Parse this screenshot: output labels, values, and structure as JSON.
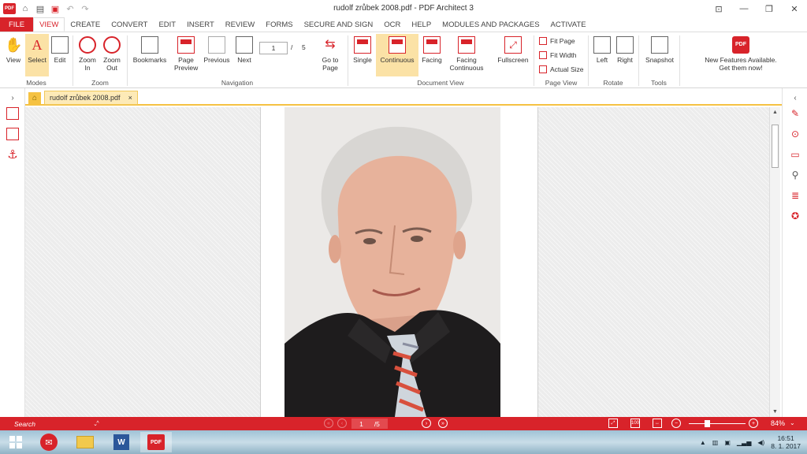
{
  "app": {
    "title": "rudolf zrůbek 2008.pdf   -   PDF Architect 3",
    "logo_text": "PDF",
    "quick_access": [
      "home-icon",
      "save-icon",
      "print-icon",
      "undo-icon",
      "redo-icon"
    ]
  },
  "menu": {
    "tabs": [
      "FILE",
      "VIEW",
      "CREATE",
      "CONVERT",
      "EDIT",
      "INSERT",
      "REVIEW",
      "FORMS",
      "SECURE AND SIGN",
      "OCR",
      "HELP",
      "MODULES AND PACKAGES",
      "ACTIVATE"
    ],
    "active": "VIEW"
  },
  "ribbon": {
    "modes": {
      "group": "Modes",
      "view": "View",
      "select": "Select",
      "edit": "Edit"
    },
    "zoom": {
      "group": "Zoom",
      "zoom_in": "Zoom In",
      "zoom_out": "Zoom Out"
    },
    "navigation": {
      "group": "Navigation",
      "bookmarks": "Bookmarks",
      "page_preview": "Page Preview",
      "previous": "Previous",
      "next": "Next",
      "current_page": "1",
      "page_sep": "/",
      "total_pages": "5",
      "go_to_page": "Go to Page"
    },
    "document_view": {
      "group": "Document View",
      "single": "Single",
      "continuous": "Continuous",
      "facing": "Facing",
      "facing_continuous": "Facing Continuous",
      "fullscreen": "Fullscreen"
    },
    "page_view": {
      "group": "Page View",
      "fit_page": "Fit Page",
      "fit_width": "Fit Width",
      "actual_size": "Actual Size"
    },
    "rotate": {
      "group": "Rotate",
      "left": "Left",
      "right": "Right"
    },
    "tools": {
      "group": "Tools",
      "snapshot": "Snapshot"
    },
    "news": {
      "line1": "New Features Available.",
      "line2": "Get them now!"
    }
  },
  "document": {
    "tab_label": "rudolf zrůbek 2008.pdf",
    "close_glyph": "×"
  },
  "statusbar": {
    "search_placeholder": "Search",
    "page_current": "1",
    "page_total": "/5",
    "zoom": "84%"
  },
  "taskbar": {
    "time": "16:51",
    "date": "8. 1. 2017"
  },
  "colors": {
    "accent": "#d8232a",
    "selected": "#fbe2a6",
    "doc_tab": "#f5c242"
  }
}
